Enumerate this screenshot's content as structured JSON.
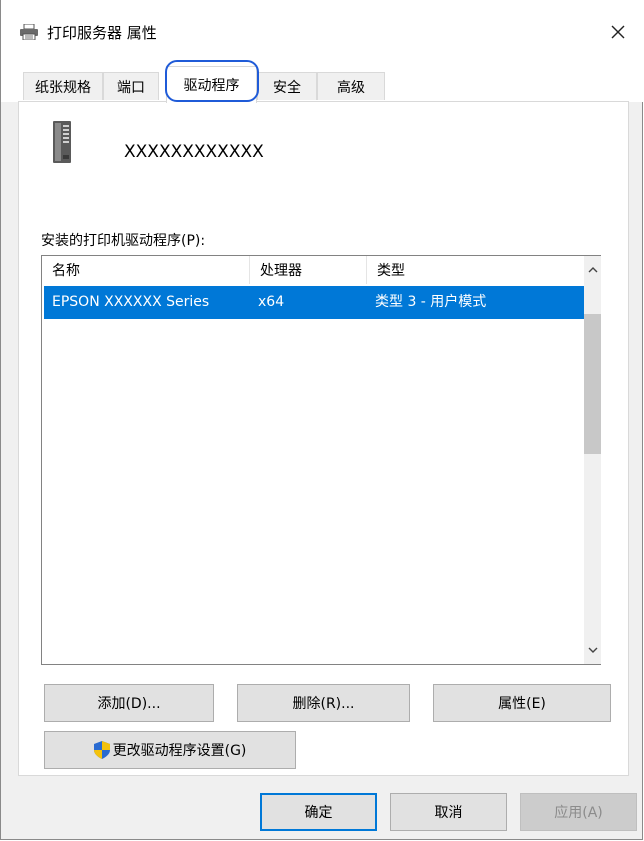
{
  "window": {
    "title": "打印服务器 属性",
    "close_glyph": "✕"
  },
  "tabs": [
    {
      "label": "纸张规格",
      "active": false
    },
    {
      "label": "端口",
      "active": false
    },
    {
      "label": "驱动程序",
      "active": true
    },
    {
      "label": "安全",
      "active": false
    },
    {
      "label": "高级",
      "active": false
    }
  ],
  "server": {
    "name": "XXXXXXXXXXXX"
  },
  "drivers": {
    "label": "安装的打印机驱动程序(P):",
    "columns": [
      "名称",
      "处理器",
      "类型"
    ],
    "rows": [
      {
        "name": "EPSON XXXXXX Series",
        "processor": "x64",
        "type": "类型 3 - 用户模式",
        "selected": true
      }
    ]
  },
  "buttons": {
    "add": "添加(D)...",
    "remove": "删除(R)...",
    "properties": "属性(E)",
    "change_settings": "更改驱动程序设置(G)",
    "ok": "确定",
    "cancel": "取消",
    "apply": "应用(A)"
  },
  "colors": {
    "highlight": "#1f5bd8",
    "selection": "#0078d7"
  }
}
